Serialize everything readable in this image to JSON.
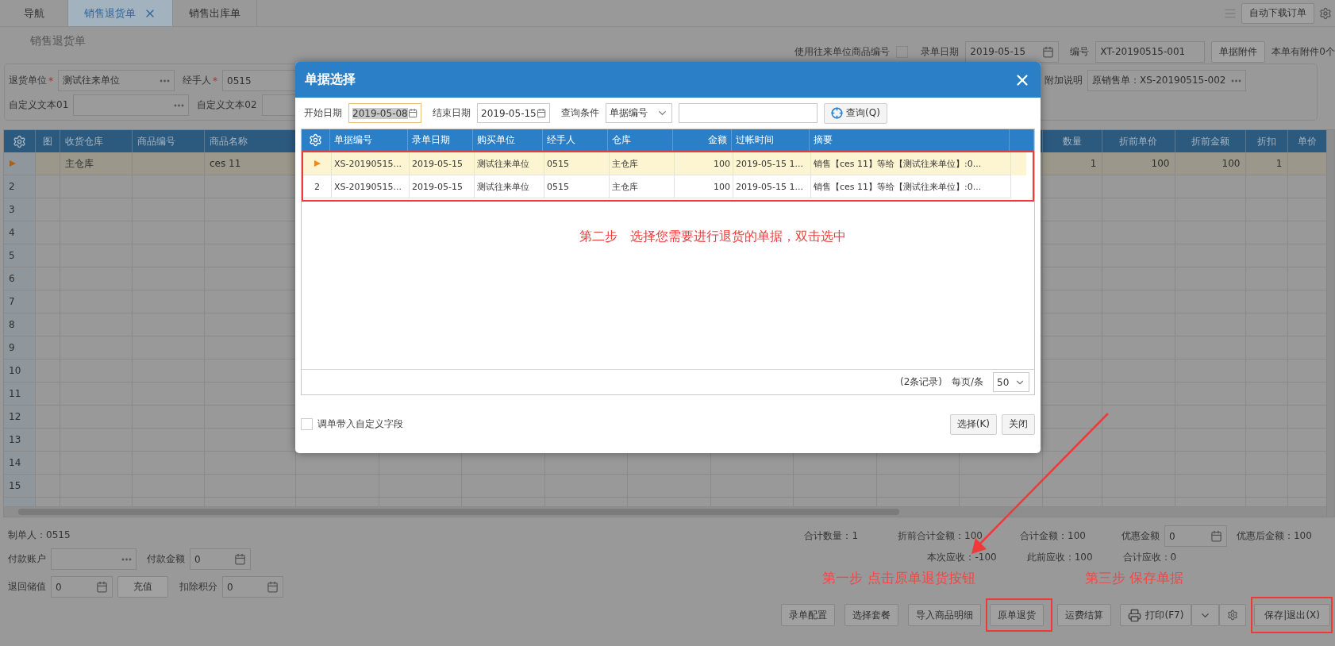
{
  "tabs": [
    {
      "label": "导航",
      "selected": false,
      "closable": false
    },
    {
      "label": "销售退货单",
      "selected": true,
      "closable": true
    },
    {
      "label": "销售出库单",
      "selected": false,
      "closable": false
    }
  ],
  "toolbar_button": "自动下载订单",
  "page_title": "销售退货单",
  "header": {
    "partner_code": {
      "label": "使用往来单位商品编号",
      "checked": false
    },
    "date": {
      "label": "录单日期",
      "value": "2019-05-15"
    },
    "number": {
      "label": "编号",
      "value": "XT-20190515-001"
    },
    "attach_button": "单据附件",
    "attach_note": "本单有附件0个"
  },
  "form": {
    "rows": [
      [
        {
          "label": "退货单位",
          "required_mark": "*",
          "value": "测试往来单位",
          "kind": "lookup"
        },
        {
          "label": "经手人",
          "required_mark": "*",
          "value": "0515",
          "kind": "text"
        }
      ],
      [
        {
          "label": "自定义文本01",
          "kind": "lookup"
        },
        {
          "label": "自定义文本02",
          "kind": "text"
        }
      ]
    ],
    "remark": {
      "label": "附加说明",
      "value": "原销售单：XS-20190515-002"
    }
  },
  "grid": {
    "left_columns": [
      "图",
      "收货仓库",
      "商品编号",
      "商品名称"
    ],
    "right_columns": [
      "数量",
      "折前单价",
      "折前金额",
      "折扣",
      "单价"
    ],
    "rows": [
      {
        "selected": true,
        "left_cells": [
          null,
          "主仓库",
          null,
          "ces 11"
        ],
        "right_cells": [
          "1",
          "100",
          "100",
          "1",
          null
        ]
      },
      {
        "selected": false,
        "number": "2"
      },
      {
        "selected": false,
        "number": "3"
      },
      {
        "selected": false,
        "number": "4"
      },
      {
        "selected": false,
        "number": "5"
      },
      {
        "selected": false,
        "number": "6"
      },
      {
        "selected": false,
        "number": "7"
      },
      {
        "selected": false,
        "number": "8"
      },
      {
        "selected": false,
        "number": "9"
      },
      {
        "selected": false,
        "number": "10"
      },
      {
        "selected": false,
        "number": "11"
      },
      {
        "selected": false,
        "number": "12"
      },
      {
        "selected": false,
        "number": "13"
      },
      {
        "selected": false,
        "number": "14"
      },
      {
        "selected": false,
        "number": "15"
      }
    ]
  },
  "footer": {
    "maker": "制单人：0515",
    "payment_account": {
      "label": "付款账户"
    },
    "payment_amount": {
      "label": "付款金额",
      "value": "0"
    },
    "stored_value": {
      "label": "退回储值",
      "value": "0"
    },
    "recharge_button": "充值",
    "points": {
      "label": "扣除积分",
      "value": "0"
    },
    "totals": [
      "合计数量：1",
      "折前合计金额：100",
      "合计金额：100"
    ],
    "discount": {
      "label": "优惠金额",
      "value": "0"
    },
    "after_discount": "优惠后金额：100",
    "receivables": [
      "本次应收：-100",
      "此前应收：100",
      "合计应收：0"
    ],
    "step1": "第一步  点击原单退货按钮",
    "step3": "第三步  保存单据",
    "buttons": [
      {
        "label": "录单配置",
        "highlighted": false
      },
      {
        "label": "选择套餐",
        "highlighted": false
      },
      {
        "label": "导入商品明细",
        "highlighted": false
      },
      {
        "label": "原单退货",
        "highlighted": true
      },
      {
        "label": "运费结算",
        "highlighted": false
      }
    ],
    "print_button": "打印(F7)",
    "save_button": {
      "label": "保存|退出(X)",
      "highlighted": true
    }
  },
  "dialog": {
    "title": "单据选择",
    "start": {
      "label": "开始日期",
      "value": "2019-05-08"
    },
    "end": {
      "label": "结束日期",
      "value": "2019-05-15"
    },
    "condition": {
      "label": "查询条件",
      "value": "单据编号"
    },
    "query_button": "查询(Q)",
    "columns": [
      "单据编号",
      "录单日期",
      "购买单位",
      "经手人",
      "仓库",
      "金额",
      "过帐时间",
      "摘要"
    ],
    "highlighted": true,
    "rows": [
      {
        "selected": true,
        "cells": [
          "XS-20190515...",
          "2019-05-15",
          "测试往来单位",
          "0515",
          "主仓库",
          "100",
          "2019-05-15 1...",
          "销售【ces 11】等给【测试往来单位】:0..."
        ]
      },
      {
        "selected": false,
        "number": "2",
        "cells": [
          "XS-20190515...",
          "2019-05-15",
          "测试往来单位",
          "0515",
          "主仓库",
          "100",
          "2019-05-15 1...",
          "销售【ces 11】等给【测试往来单位】:0..."
        ]
      }
    ],
    "hint": "第二步　选择您需要进行退货的单据，双击选中",
    "record_count": "(2条记录)",
    "page_size_label": "每页/条",
    "page_size": "50",
    "carry_fields": {
      "label": "调单带入自定义字段",
      "checked": false
    },
    "buttons": [
      "选择(K)",
      "关闭"
    ]
  }
}
